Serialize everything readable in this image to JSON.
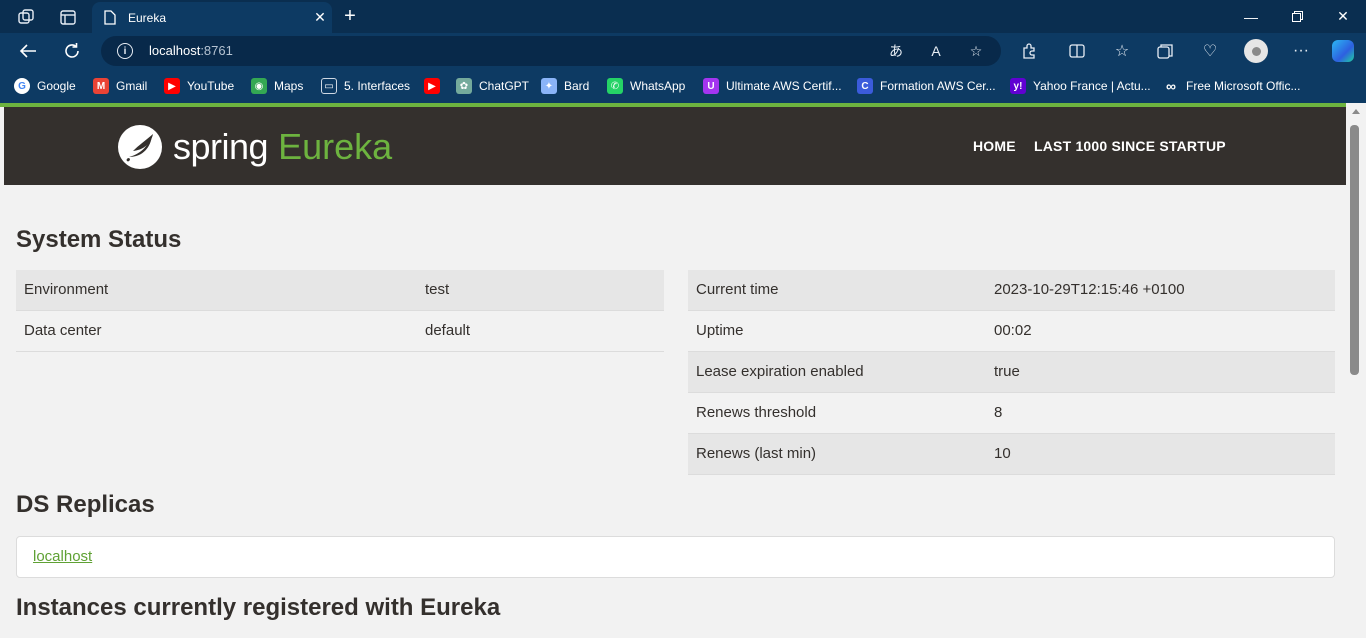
{
  "browser": {
    "tab": {
      "title": "Eureka"
    },
    "address": {
      "host": "localhost",
      "port": ":8761"
    },
    "bookmarks": [
      {
        "label": "Google",
        "icon": "google-icon",
        "color": "#ffffff"
      },
      {
        "label": "Gmail",
        "icon": "gmail-icon",
        "color": "#ea4335"
      },
      {
        "label": "YouTube",
        "icon": "youtube-icon",
        "color": "#ff0000"
      },
      {
        "label": "Maps",
        "icon": "maps-icon",
        "color": "#34a853"
      },
      {
        "label": "5. Interfaces",
        "icon": "page-icon",
        "color": "#cfd8e3"
      },
      {
        "label": "",
        "icon": "youtube-icon",
        "color": "#ff0000"
      },
      {
        "label": "ChatGPT",
        "icon": "chatgpt-icon",
        "color": "#74aa9c"
      },
      {
        "label": "Bard",
        "icon": "bard-icon",
        "color": "#8ab4f8"
      },
      {
        "label": "WhatsApp",
        "icon": "whatsapp-icon",
        "color": "#25d366"
      },
      {
        "label": "Ultimate AWS Certif...",
        "icon": "udemy-icon",
        "color": "#a435f0"
      },
      {
        "label": "Formation AWS Cer...",
        "icon": "formation-icon",
        "color": "#3b5bdb"
      },
      {
        "label": "Yahoo France | Actu...",
        "icon": "yahoo-icon",
        "color": "#6001d2"
      },
      {
        "label": "Free Microsoft Offic...",
        "icon": "infinity-icon",
        "color": "#1a1a1a"
      }
    ]
  },
  "header": {
    "logo_text": "spring",
    "logo_product": "Eureka",
    "nav": [
      "HOME",
      "LAST 1000 SINCE STARTUP"
    ]
  },
  "system_status": {
    "title": "System Status",
    "left": [
      {
        "key": "Environment",
        "value": "test"
      },
      {
        "key": "Data center",
        "value": "default"
      }
    ],
    "right": [
      {
        "key": "Current time",
        "value": "2023-10-29T12:15:46 +0100"
      },
      {
        "key": "Uptime",
        "value": "00:02"
      },
      {
        "key": "Lease expiration enabled",
        "value": "true"
      },
      {
        "key": "Renews threshold",
        "value": "8"
      },
      {
        "key": "Renews (last min)",
        "value": "10"
      }
    ]
  },
  "ds_replicas": {
    "title": "DS Replicas",
    "items": [
      "localhost"
    ]
  },
  "instances": {
    "title": "Instances currently registered with Eureka"
  },
  "colors": {
    "spring_green": "#6db33f",
    "header_bg": "#34302d",
    "chrome_bg": "#0d3a63"
  }
}
